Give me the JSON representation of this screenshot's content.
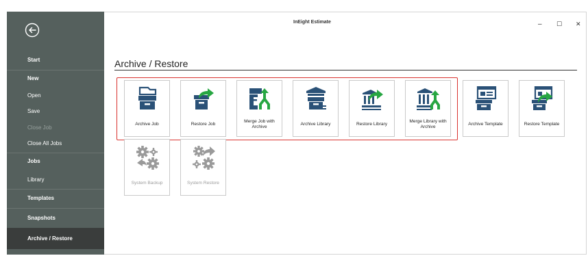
{
  "window": {
    "title": "InEight Estimate",
    "controls": {
      "minimize": "–",
      "maximize": "☐",
      "close": "✕"
    }
  },
  "sidebar": {
    "items": [
      {
        "label": "Start"
      },
      {
        "label": "New"
      },
      {
        "label": "Open"
      },
      {
        "label": "Save"
      },
      {
        "label": "Close Job"
      },
      {
        "label": "Close All Jobs"
      },
      {
        "label": "Jobs"
      },
      {
        "label": "Library"
      },
      {
        "label": "Templates"
      },
      {
        "label": "Snapshots"
      },
      {
        "label": "Archive / Restore"
      }
    ]
  },
  "main": {
    "section_title": "Archive / Restore",
    "tiles": [
      {
        "label": "Archive Job",
        "icon": "archive-job-icon"
      },
      {
        "label": "Restore Job",
        "icon": "restore-job-icon"
      },
      {
        "label": "Merge Job with Archive",
        "icon": "merge-job-icon"
      },
      {
        "label": "Archive Library",
        "icon": "archive-library-icon"
      },
      {
        "label": "Restore Library",
        "icon": "restore-library-icon"
      },
      {
        "label": "Merge Library with Archive",
        "icon": "merge-library-icon"
      },
      {
        "label": "Archive Template",
        "icon": "archive-template-icon"
      },
      {
        "label": "Restore Template",
        "icon": "restore-template-icon"
      },
      {
        "label": "System Backup",
        "icon": "system-backup-icon"
      },
      {
        "label": "System Restore",
        "icon": "system-restore-icon"
      }
    ]
  },
  "colors": {
    "sidebar": "#55605d",
    "active": "#3a3d3c",
    "icon_blue": "#2a5177",
    "icon_green": "#27a642",
    "highlight": "#d9312d",
    "gear_gray": "#9a9a9a"
  }
}
